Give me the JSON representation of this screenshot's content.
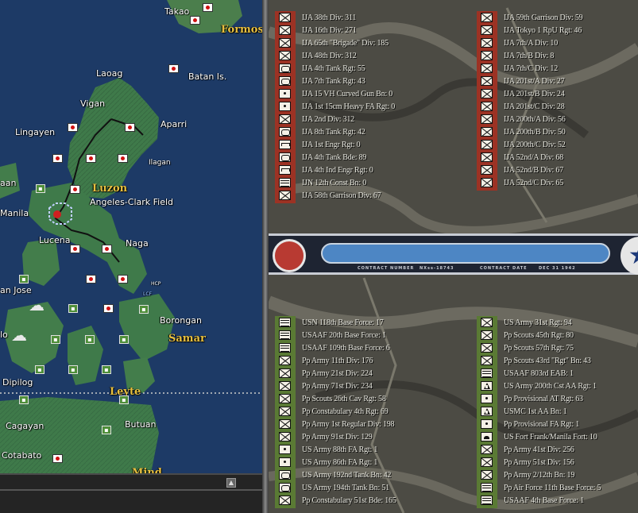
{
  "map": {
    "labels": {
      "takao": "Takao",
      "formosa": "Formos:",
      "laoag": "Laoag",
      "batan": "Batan Is.",
      "vigan": "Vigan",
      "aparri": "Aparri",
      "lingayen": "Lingayen",
      "ilagan": "Ilagan",
      "luzon": "Luzon",
      "aan": "aan",
      "angeles": "Angeles-Clark Field",
      "manila": "Manila",
      "lucena": "Lucena",
      "naga": "Naga",
      "san_jose": "an Jose",
      "borongan": "Borongan",
      "samar": "Samar",
      "lo": "lo",
      "dipilog": "Dipilog",
      "leyte": "Leyte",
      "cagayan": "Cagayan",
      "butuan": "Butuan",
      "cotabato": "Cotabato",
      "mind": "Mind"
    },
    "icon_text": {
      "hcp": "HCP",
      "lcf": "LCF"
    }
  },
  "japanese_units": {
    "left": [
      {
        "icon": "inf",
        "name": "IJA 38th Div: 311"
      },
      {
        "icon": "inf",
        "name": "IJA 16th Div: 271"
      },
      {
        "icon": "inf",
        "name": "IJA 65th \"Brigade\" Div: 185"
      },
      {
        "icon": "inf",
        "name": "IJA 48th Div: 312"
      },
      {
        "icon": "arm",
        "name": "IJA 4th Tank Rgt: 55"
      },
      {
        "icon": "arm",
        "name": "IJA 7th Tank Rgt: 43"
      },
      {
        "icon": "art",
        "name": "IJA 15 VH Curved Gun Bn: 0"
      },
      {
        "icon": "art",
        "name": "IJA 1st 15cm Heavy FA Rgt: 0"
      },
      {
        "icon": "inf",
        "name": "IJA 2nd Div: 312"
      },
      {
        "icon": "arm",
        "name": "IJA 8th Tank Rgt: 42"
      },
      {
        "icon": "eng",
        "name": "IJA 1st Engr Rgt: 0"
      },
      {
        "icon": "arm",
        "name": "IJA 4th Tank Bde: 89"
      },
      {
        "icon": "eng",
        "name": "IJA 4th Ind Engr Rgt: 0"
      },
      {
        "icon": "base",
        "name": "IJN 12th Const Bn: 0"
      },
      {
        "icon": "inf",
        "name": "IJA 58th Garrison Div: 67"
      }
    ],
    "right": [
      {
        "icon": "inf",
        "name": "IJA 59th Garrison Div: 59"
      },
      {
        "icon": "inf",
        "name": "IJA Tokyo 1 RpU Rgt: 46"
      },
      {
        "icon": "inf",
        "name": "IJA 7th/A Div: 10"
      },
      {
        "icon": "inf",
        "name": "IJA 7th/B Div: 8"
      },
      {
        "icon": "inf",
        "name": "IJA 7th/C Div: 12"
      },
      {
        "icon": "inf",
        "name": "IJA 201st/A Div: 27"
      },
      {
        "icon": "inf",
        "name": "IJA 201st/B Div: 24"
      },
      {
        "icon": "inf",
        "name": "IJA 201st/C Div: 28"
      },
      {
        "icon": "inf",
        "name": "IJA 200th/A Div: 56"
      },
      {
        "icon": "inf",
        "name": "IJA 200th/B Div: 50"
      },
      {
        "icon": "inf",
        "name": "IJA 200th/C Div: 52"
      },
      {
        "icon": "inf",
        "name": "IJA 52nd/A Div: 68"
      },
      {
        "icon": "inf",
        "name": "IJA 52nd/B Div: 67"
      },
      {
        "icon": "inf",
        "name": "IJA 52nd/C Div: 65"
      }
    ]
  },
  "banner": {
    "contract_number_label": "CONTRACT NUMBER",
    "contract_number": "NXss-18743",
    "contract_date_label": "CONTRACT DATE",
    "contract_date": "DEC 31 1942",
    "star": "★"
  },
  "allied_units": {
    "left": [
      {
        "icon": "base",
        "name": "USN 118th Base Force: 17"
      },
      {
        "icon": "base",
        "name": "USAAF 20th Base Force: 1"
      },
      {
        "icon": "base",
        "name": "USAAF 109th Base Force: 6"
      },
      {
        "icon": "inf",
        "name": "Pp Army 11th Div: 176"
      },
      {
        "icon": "inf",
        "name": "Pp Army 21st Div: 224"
      },
      {
        "icon": "inf",
        "name": "Pp Army 71st Div: 234"
      },
      {
        "icon": "inf",
        "name": "Pp Scouts 26th Cav Rgt: 58"
      },
      {
        "icon": "inf",
        "name": "Pp Constabulary 4th Rgt: 69"
      },
      {
        "icon": "inf",
        "name": "Pp Army 1st Regular Div: 198"
      },
      {
        "icon": "inf",
        "name": "Pp Army 91st Div: 129"
      },
      {
        "icon": "art",
        "name": "US Army 88th FA Rgt: 1"
      },
      {
        "icon": "art",
        "name": "US Army 86th FA Rgt: 1"
      },
      {
        "icon": "arm",
        "name": "US Army 192nd Tank Bn: 42"
      },
      {
        "icon": "arm",
        "name": "US Army 194th Tank Bn: 51"
      },
      {
        "icon": "inf",
        "name": "Pp Constabulary 51st Bde: 165"
      }
    ],
    "right": [
      {
        "icon": "inf",
        "name": "US Army 31st Rgt: 94"
      },
      {
        "icon": "inf",
        "name": "Pp Scouts 45th Rgt: 80"
      },
      {
        "icon": "inf",
        "name": "Pp Scouts 57th Rgt: 75"
      },
      {
        "icon": "inf",
        "name": "Pp Scouts 43rd \"Rgt\" Bn: 43"
      },
      {
        "icon": "base",
        "name": "USAAF 803rd EAB: 1"
      },
      {
        "icon": "aa",
        "name": "US Army 200th Cst AA Rgt: 1"
      },
      {
        "icon": "art",
        "name": "Pp Provisional AT Rgt: 63"
      },
      {
        "icon": "aa",
        "name": "USMC 1st AA Bn: 1"
      },
      {
        "icon": "art",
        "name": "Pp Provisional FA Rgt: 1"
      },
      {
        "icon": "fort",
        "name": "US Fort Frank/Manila Fort: 10"
      },
      {
        "icon": "inf",
        "name": "Pp Army 41st Div: 256"
      },
      {
        "icon": "inf",
        "name": "Pp Army 51st Div: 156"
      },
      {
        "icon": "inf",
        "name": "Pp Army 2/12th Bn: 19"
      },
      {
        "icon": "base",
        "name": "Pp Air Force 11th Base Force: 5"
      },
      {
        "icon": "base",
        "name": "USAAF 4th Base Force: 1"
      }
    ]
  },
  "colors": {
    "ocean": "#1d3a66",
    "land": "#3f7a4a",
    "japan_strip": "#9c3224",
    "allied_strip": "#5a7a34",
    "seal": "#b83a32",
    "bar": "#4d86c4"
  }
}
